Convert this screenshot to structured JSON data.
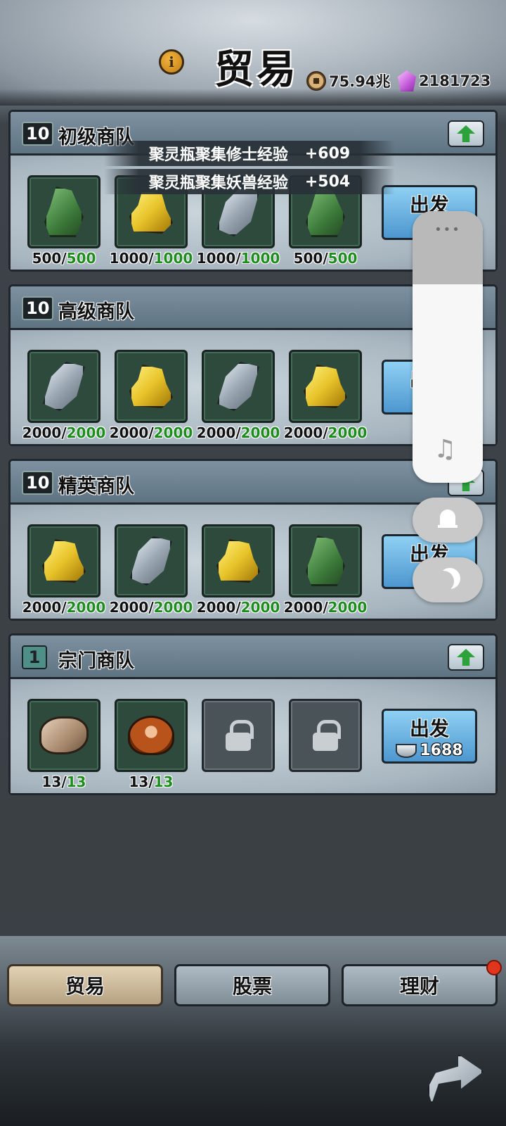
{
  "header": {
    "title": "贸易",
    "info_icon": "info-icon",
    "copper": "75.94兆",
    "gems": "2181723"
  },
  "notifications": [
    {
      "text": "聚灵瓶聚集修士经验",
      "value": "+609"
    },
    {
      "text": "聚灵瓶聚集妖兽经验",
      "value": "+504"
    }
  ],
  "caravans": [
    {
      "level": "10",
      "name": "初级商队",
      "go_label": "出发",
      "items": [
        {
          "icon": "green-ore",
          "cur": "500/",
          "max": "500"
        },
        {
          "icon": "gold-ore",
          "cur": "1000/",
          "max": "1000"
        },
        {
          "icon": "iron-ore",
          "cur": "1000/",
          "max": "1000"
        },
        {
          "icon": "green-ore",
          "cur": "500/",
          "max": "500"
        }
      ]
    },
    {
      "level": "10",
      "name": "高级商队",
      "go_label": "出发",
      "items": [
        {
          "icon": "iron-ore",
          "cur": "2000/",
          "max": "2000"
        },
        {
          "icon": "gold-ore",
          "cur": "2000/",
          "max": "2000"
        },
        {
          "icon": "iron-ore",
          "cur": "2000/",
          "max": "2000"
        },
        {
          "icon": "gold-ore",
          "cur": "2000/",
          "max": "2000"
        }
      ]
    },
    {
      "level": "10",
      "name": "精英商队",
      "go_label": "出发",
      "items": [
        {
          "icon": "gold-ore",
          "cur": "2000/",
          "max": "2000"
        },
        {
          "icon": "iron-ore",
          "cur": "2000/",
          "max": "2000"
        },
        {
          "icon": "gold-ore",
          "cur": "2000/",
          "max": "2000"
        },
        {
          "icon": "green-ore",
          "cur": "2000/",
          "max": "2000"
        }
      ]
    },
    {
      "level": "1",
      "name": "宗门商队",
      "go_label": "出发",
      "go_cost": "1688",
      "items": [
        {
          "icon": "stone",
          "cur": "13/",
          "max": "13"
        },
        {
          "icon": "herb",
          "cur": "13/",
          "max": "13"
        }
      ]
    }
  ],
  "tabs": {
    "trade": "贸易",
    "stocks": "股票",
    "finance": "理财"
  },
  "floating_panel": {
    "dots": "•••",
    "music_icon": "♫"
  },
  "colors": {
    "accent_green": "#1d8d1d",
    "go_button": "#4d97cf",
    "notice_dot": "#e0361e"
  }
}
